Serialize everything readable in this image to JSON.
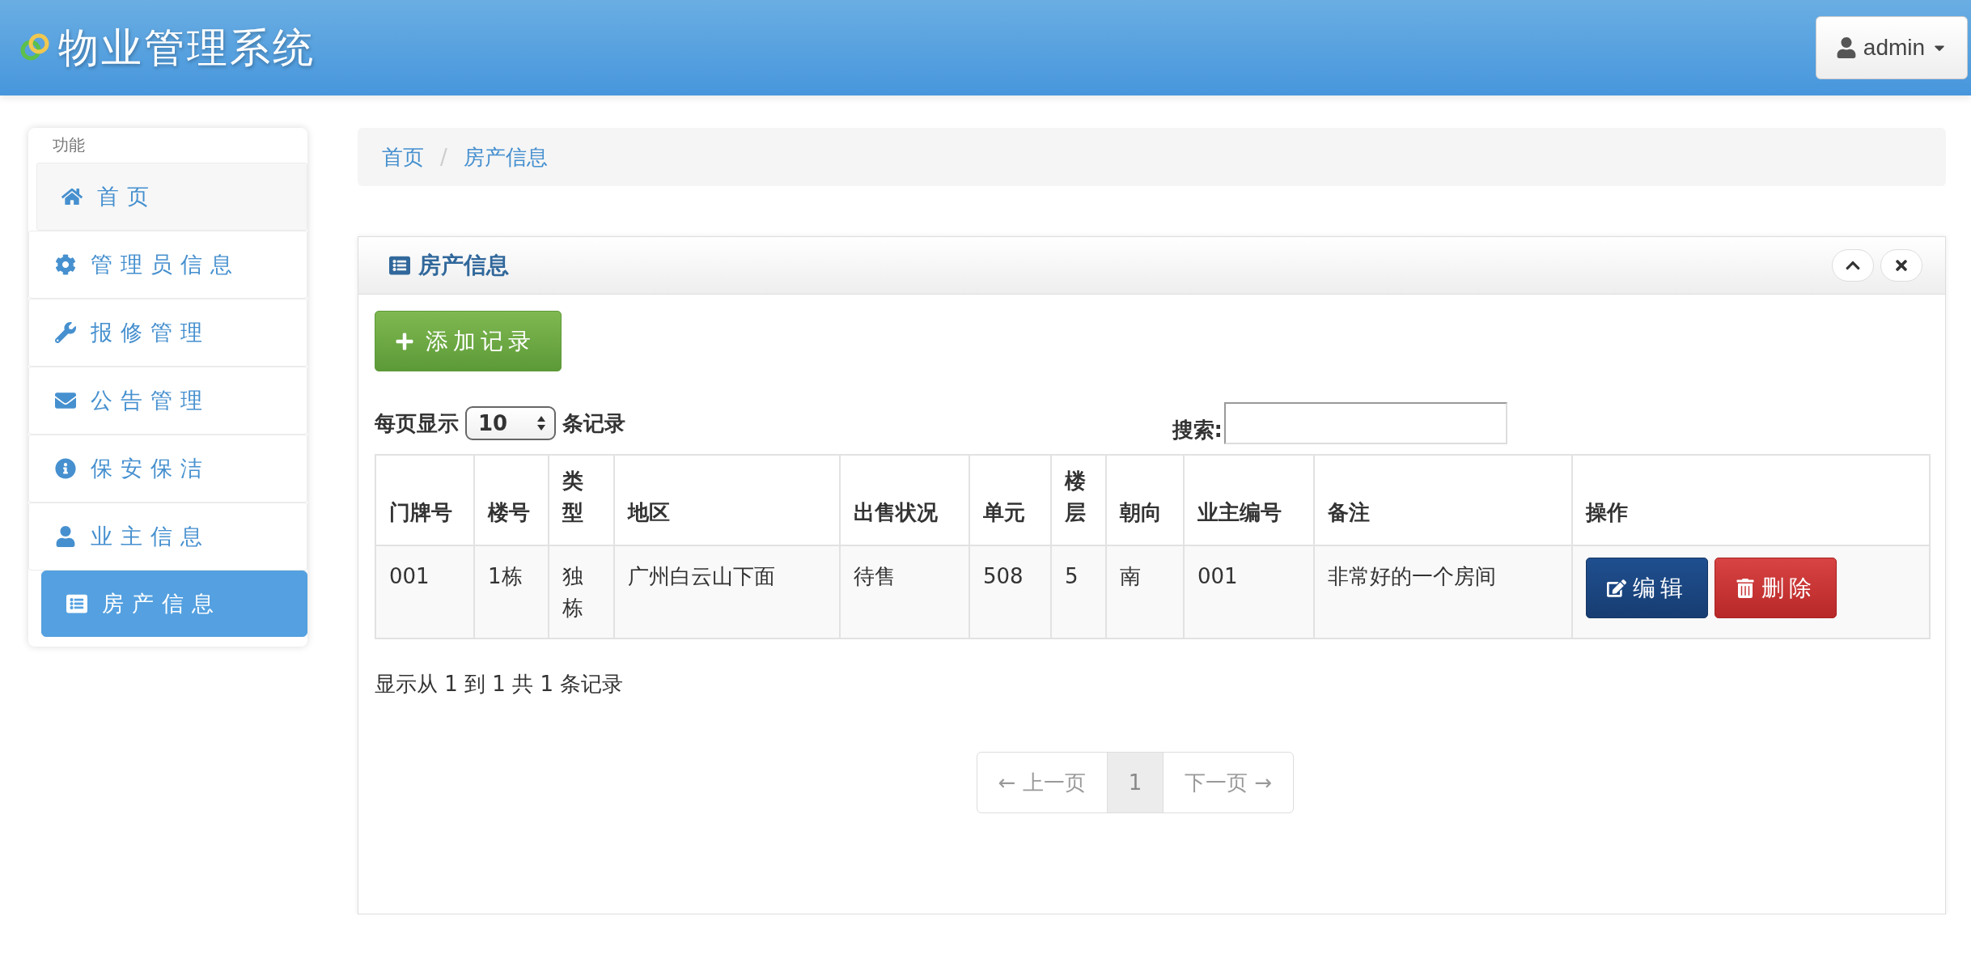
{
  "header": {
    "title": "物业管理系统",
    "user": "admin"
  },
  "sidebar": {
    "heading": "功能",
    "items": [
      {
        "label": "首页",
        "kind": "home",
        "selected": false
      },
      {
        "label": "管理员信息",
        "kind": "gear",
        "selected": false
      },
      {
        "label": "报修管理",
        "kind": "wrench",
        "selected": false
      },
      {
        "label": "公告管理",
        "kind": "envelope",
        "selected": false
      },
      {
        "label": "保安保洁",
        "kind": "info",
        "selected": false
      },
      {
        "label": "业主信息",
        "kind": "user",
        "selected": false
      },
      {
        "label": "房产信息",
        "kind": "list",
        "selected": true
      }
    ]
  },
  "breadcrumb": {
    "items": [
      "首页",
      "房产信息"
    ],
    "separator": "/"
  },
  "panel": {
    "title": "房产信息"
  },
  "add_button": "添加记录",
  "page_length": {
    "prefix": "每页显示",
    "value": "10",
    "suffix": "条记录"
  },
  "search": {
    "label": "搜索:"
  },
  "table": {
    "columns": [
      "门牌号",
      "楼号",
      "类型",
      "地区",
      "出售状况",
      "单元",
      "楼层",
      "朝向",
      "业主编号",
      "备注",
      "操作"
    ],
    "rows": [
      {
        "cells": [
          "001",
          "1栋",
          "独栋",
          "广州白云山下面",
          "待售",
          "508",
          "5",
          "南",
          "001",
          "非常好的一个房间"
        ],
        "actions": [
          {
            "label": "编辑",
            "kind": "edit"
          },
          {
            "label": "删除",
            "kind": "delete"
          }
        ]
      }
    ]
  },
  "info": "显示从 1 到 1 共 1 条记录",
  "pagination": [
    {
      "label": "← 上一页",
      "selected": false,
      "disabled": true
    },
    {
      "label": "1",
      "selected": true,
      "disabled": false
    },
    {
      "label": "下一页 →",
      "selected": false,
      "disabled": true
    }
  ]
}
